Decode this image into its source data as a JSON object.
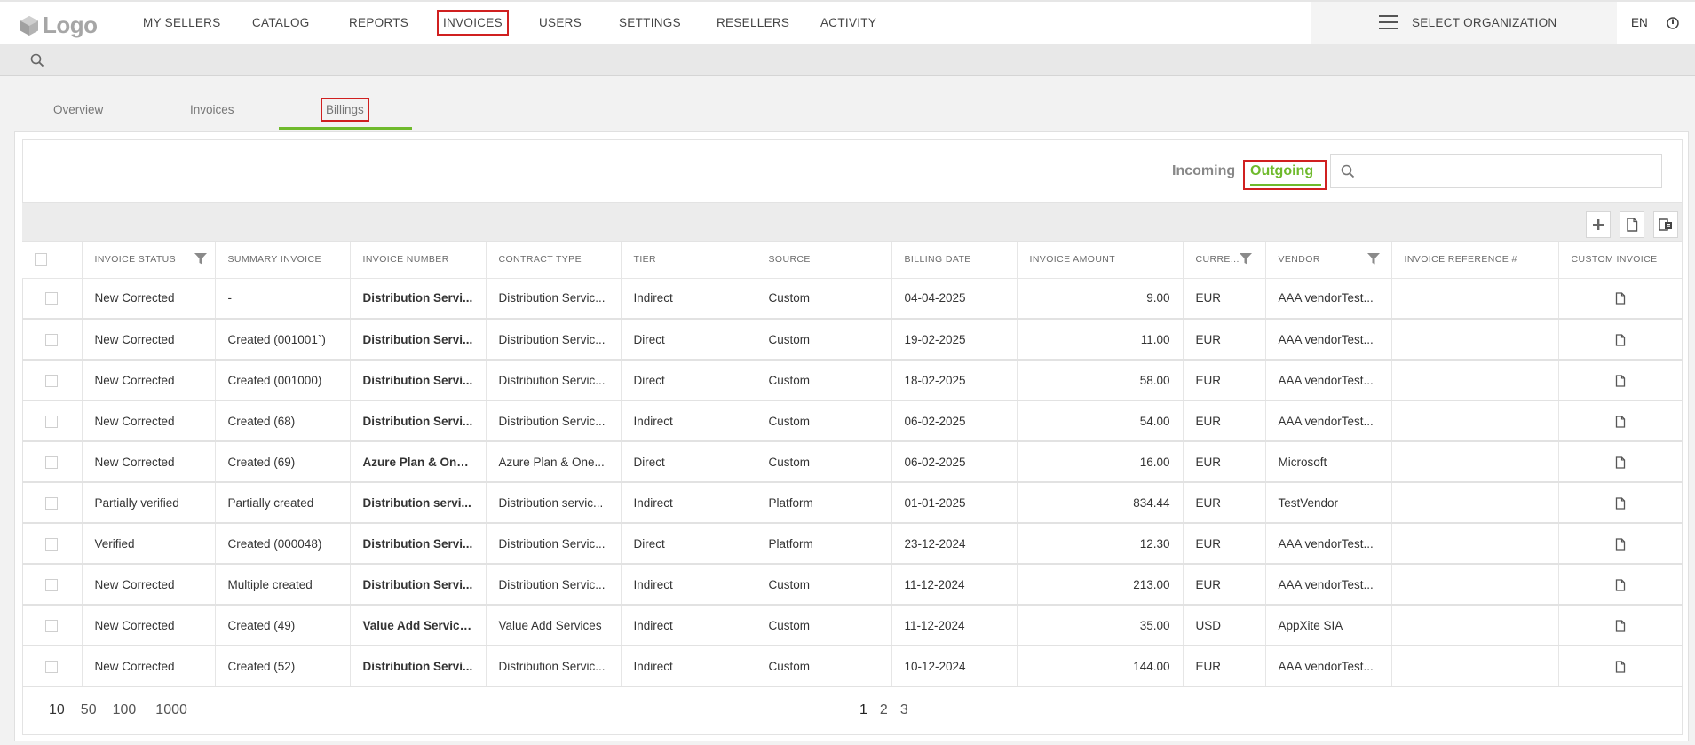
{
  "app": {
    "logo_text": "Logo"
  },
  "nav": {
    "items": [
      "MY SELLERS",
      "CATALOG",
      "REPORTS",
      "INVOICES",
      "USERS",
      "SETTINGS",
      "RESELLERS",
      "ACTIVITY"
    ],
    "active": "INVOICES",
    "org_label": "SELECT ORGANIZATION",
    "language": "EN"
  },
  "tabs": {
    "items": [
      "Overview",
      "Invoices",
      "Billings"
    ],
    "active": "Billings"
  },
  "direction": {
    "incoming": "Incoming",
    "outgoing": "Outgoing",
    "active": "Outgoing"
  },
  "grid_search": {
    "placeholder": "",
    "value": ""
  },
  "toolbar": {
    "icons": [
      "plus-icon",
      "document-icon",
      "export-icon"
    ]
  },
  "table": {
    "columns": [
      "INVOICE STATUS",
      "SUMMARY INVOICE",
      "INVOICE NUMBER",
      "CONTRACT TYPE",
      "TIER",
      "SOURCE",
      "BILLING DATE",
      "INVOICE AMOUNT",
      "CURRE...",
      "VENDOR",
      "INVOICE REFERENCE #",
      "CUSTOM INVOICE"
    ],
    "filterable_columns": [
      "INVOICE STATUS",
      "CURRE...",
      "VENDOR"
    ],
    "rows": [
      [
        "New Corrected",
        "-",
        "Distribution Servi...",
        "Distribution Servic...",
        "Indirect",
        "Custom",
        "04-04-2025",
        "9.00",
        "EUR",
        "AAA vendorTest...",
        ""
      ],
      [
        "New Corrected",
        "Created (001001`)",
        "Distribution Servi...",
        "Distribution Servic...",
        "Direct",
        "Custom",
        "19-02-2025",
        "11.00",
        "EUR",
        "AAA vendorTest...",
        ""
      ],
      [
        "New Corrected",
        "Created (001000)",
        "Distribution Servi...",
        "Distribution Servic...",
        "Direct",
        "Custom",
        "18-02-2025",
        "58.00",
        "EUR",
        "AAA vendorTest...",
        ""
      ],
      [
        "New Corrected",
        "Created (68)",
        "Distribution Servi...",
        "Distribution Servic...",
        "Indirect",
        "Custom",
        "06-02-2025",
        "54.00",
        "EUR",
        "AAA vendorTest...",
        ""
      ],
      [
        "New Corrected",
        "Created (69)",
        "Azure Plan & One...",
        "Azure Plan & One...",
        "Direct",
        "Custom",
        "06-02-2025",
        "16.00",
        "EUR",
        "Microsoft",
        ""
      ],
      [
        "Partially verified",
        "Partially created",
        "Distribution servi...",
        "Distribution servic...",
        "Indirect",
        "Platform",
        "01-01-2025",
        "834.44",
        "EUR",
        "TestVendor",
        ""
      ],
      [
        "Verified",
        "Created (000048)",
        "Distribution Servi...",
        "Distribution Servic...",
        "Direct",
        "Platform",
        "23-12-2024",
        "12.30",
        "EUR",
        "AAA vendorTest...",
        ""
      ],
      [
        "New Corrected",
        "Multiple created",
        "Distribution Servi...",
        "Distribution Servic...",
        "Indirect",
        "Custom",
        "11-12-2024",
        "213.00",
        "EUR",
        "AAA vendorTest...",
        ""
      ],
      [
        "New Corrected",
        "Created (49)",
        "Value Add Service...",
        "Value Add Services",
        "Indirect",
        "Custom",
        "11-12-2024",
        "35.00",
        "USD",
        "AppXite SIA",
        ""
      ],
      [
        "New Corrected",
        "Created (52)",
        "Distribution Servi...",
        "Distribution Servic...",
        "Indirect",
        "Custom",
        "10-12-2024",
        "144.00",
        "EUR",
        "AAA vendorTest...",
        ""
      ]
    ]
  },
  "pager": {
    "sizes": [
      "10",
      "50",
      "100",
      "1000"
    ],
    "selected_size": "10",
    "pages": [
      "1",
      "2",
      "3"
    ],
    "current_page": "1"
  },
  "colors": {
    "accent": "#6fba2c",
    "highlight_box": "#d02020"
  }
}
